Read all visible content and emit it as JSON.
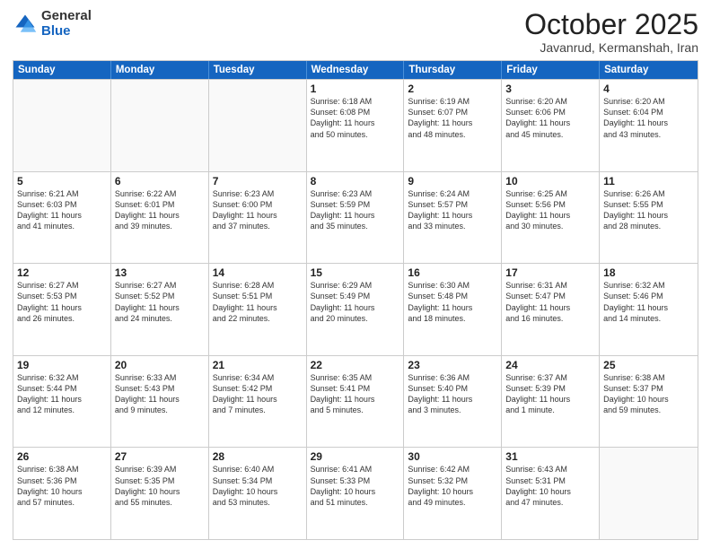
{
  "logo": {
    "general": "General",
    "blue": "Blue"
  },
  "header": {
    "month": "October 2025",
    "location": "Javanrud, Kermanshah, Iran"
  },
  "weekdays": [
    "Sunday",
    "Monday",
    "Tuesday",
    "Wednesday",
    "Thursday",
    "Friday",
    "Saturday"
  ],
  "rows": [
    [
      {
        "day": "",
        "info": "",
        "empty": true
      },
      {
        "day": "",
        "info": "",
        "empty": true
      },
      {
        "day": "",
        "info": "",
        "empty": true
      },
      {
        "day": "1",
        "info": "Sunrise: 6:18 AM\nSunset: 6:08 PM\nDaylight: 11 hours\nand 50 minutes."
      },
      {
        "day": "2",
        "info": "Sunrise: 6:19 AM\nSunset: 6:07 PM\nDaylight: 11 hours\nand 48 minutes."
      },
      {
        "day": "3",
        "info": "Sunrise: 6:20 AM\nSunset: 6:06 PM\nDaylight: 11 hours\nand 45 minutes."
      },
      {
        "day": "4",
        "info": "Sunrise: 6:20 AM\nSunset: 6:04 PM\nDaylight: 11 hours\nand 43 minutes."
      }
    ],
    [
      {
        "day": "5",
        "info": "Sunrise: 6:21 AM\nSunset: 6:03 PM\nDaylight: 11 hours\nand 41 minutes."
      },
      {
        "day": "6",
        "info": "Sunrise: 6:22 AM\nSunset: 6:01 PM\nDaylight: 11 hours\nand 39 minutes."
      },
      {
        "day": "7",
        "info": "Sunrise: 6:23 AM\nSunset: 6:00 PM\nDaylight: 11 hours\nand 37 minutes."
      },
      {
        "day": "8",
        "info": "Sunrise: 6:23 AM\nSunset: 5:59 PM\nDaylight: 11 hours\nand 35 minutes."
      },
      {
        "day": "9",
        "info": "Sunrise: 6:24 AM\nSunset: 5:57 PM\nDaylight: 11 hours\nand 33 minutes."
      },
      {
        "day": "10",
        "info": "Sunrise: 6:25 AM\nSunset: 5:56 PM\nDaylight: 11 hours\nand 30 minutes."
      },
      {
        "day": "11",
        "info": "Sunrise: 6:26 AM\nSunset: 5:55 PM\nDaylight: 11 hours\nand 28 minutes."
      }
    ],
    [
      {
        "day": "12",
        "info": "Sunrise: 6:27 AM\nSunset: 5:53 PM\nDaylight: 11 hours\nand 26 minutes."
      },
      {
        "day": "13",
        "info": "Sunrise: 6:27 AM\nSunset: 5:52 PM\nDaylight: 11 hours\nand 24 minutes."
      },
      {
        "day": "14",
        "info": "Sunrise: 6:28 AM\nSunset: 5:51 PM\nDaylight: 11 hours\nand 22 minutes."
      },
      {
        "day": "15",
        "info": "Sunrise: 6:29 AM\nSunset: 5:49 PM\nDaylight: 11 hours\nand 20 minutes."
      },
      {
        "day": "16",
        "info": "Sunrise: 6:30 AM\nSunset: 5:48 PM\nDaylight: 11 hours\nand 18 minutes."
      },
      {
        "day": "17",
        "info": "Sunrise: 6:31 AM\nSunset: 5:47 PM\nDaylight: 11 hours\nand 16 minutes."
      },
      {
        "day": "18",
        "info": "Sunrise: 6:32 AM\nSunset: 5:46 PM\nDaylight: 11 hours\nand 14 minutes."
      }
    ],
    [
      {
        "day": "19",
        "info": "Sunrise: 6:32 AM\nSunset: 5:44 PM\nDaylight: 11 hours\nand 12 minutes."
      },
      {
        "day": "20",
        "info": "Sunrise: 6:33 AM\nSunset: 5:43 PM\nDaylight: 11 hours\nand 9 minutes."
      },
      {
        "day": "21",
        "info": "Sunrise: 6:34 AM\nSunset: 5:42 PM\nDaylight: 11 hours\nand 7 minutes."
      },
      {
        "day": "22",
        "info": "Sunrise: 6:35 AM\nSunset: 5:41 PM\nDaylight: 11 hours\nand 5 minutes."
      },
      {
        "day": "23",
        "info": "Sunrise: 6:36 AM\nSunset: 5:40 PM\nDaylight: 11 hours\nand 3 minutes."
      },
      {
        "day": "24",
        "info": "Sunrise: 6:37 AM\nSunset: 5:39 PM\nDaylight: 11 hours\nand 1 minute."
      },
      {
        "day": "25",
        "info": "Sunrise: 6:38 AM\nSunset: 5:37 PM\nDaylight: 10 hours\nand 59 minutes."
      }
    ],
    [
      {
        "day": "26",
        "info": "Sunrise: 6:38 AM\nSunset: 5:36 PM\nDaylight: 10 hours\nand 57 minutes."
      },
      {
        "day": "27",
        "info": "Sunrise: 6:39 AM\nSunset: 5:35 PM\nDaylight: 10 hours\nand 55 minutes."
      },
      {
        "day": "28",
        "info": "Sunrise: 6:40 AM\nSunset: 5:34 PM\nDaylight: 10 hours\nand 53 minutes."
      },
      {
        "day": "29",
        "info": "Sunrise: 6:41 AM\nSunset: 5:33 PM\nDaylight: 10 hours\nand 51 minutes."
      },
      {
        "day": "30",
        "info": "Sunrise: 6:42 AM\nSunset: 5:32 PM\nDaylight: 10 hours\nand 49 minutes."
      },
      {
        "day": "31",
        "info": "Sunrise: 6:43 AM\nSunset: 5:31 PM\nDaylight: 10 hours\nand 47 minutes."
      },
      {
        "day": "",
        "info": "",
        "empty": true
      }
    ]
  ]
}
